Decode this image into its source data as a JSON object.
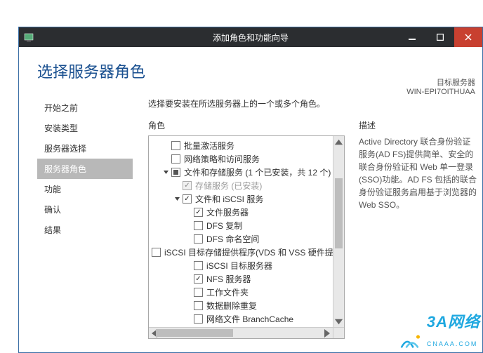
{
  "window": {
    "title": "添加角色和功能向导"
  },
  "header": {
    "page_title": "选择服务器角色",
    "dest_label": "目标服务器",
    "dest_name": "WIN-EPI7OITHUAA"
  },
  "nav": {
    "items": [
      {
        "label": "开始之前",
        "selected": false,
        "sub": false
      },
      {
        "label": "安装类型",
        "selected": false,
        "sub": false
      },
      {
        "label": "服务器选择",
        "selected": false,
        "sub": false
      },
      {
        "label": "服务器角色",
        "selected": true,
        "sub": false
      },
      {
        "label": "功能",
        "selected": false,
        "sub": false
      },
      {
        "label": "确认",
        "selected": false,
        "sub": false
      },
      {
        "label": "结果",
        "selected": false,
        "sub": false
      }
    ]
  },
  "main": {
    "instruction": "选择要安装在所选服务器上的一个或多个角色。",
    "roles_header": "角色",
    "desc_header": "描述",
    "description": "Active Directory 联合身份验证服务(AD FS)提供简单、安全的联合身份验证和 Web 单一登录(SSO)功能。AD FS 包括的联合身份验证服务启用基于浏览器的 Web SSO。"
  },
  "tree": [
    {
      "indent": 1,
      "expander": "none",
      "cb": "unchecked",
      "label": "批量激活服务"
    },
    {
      "indent": 1,
      "expander": "none",
      "cb": "unchecked",
      "label": "网络策略和访问服务"
    },
    {
      "indent": 1,
      "expander": "open",
      "cb": "mixed",
      "label": "文件和存储服务 (1 个已安装，共 12 个)"
    },
    {
      "indent": 2,
      "expander": "none",
      "cb": "checked",
      "disabled": true,
      "label": "存储服务 (已安装)"
    },
    {
      "indent": 2,
      "expander": "open",
      "cb": "checked",
      "label": "文件和 iSCSI 服务"
    },
    {
      "indent": 3,
      "expander": "none",
      "cb": "checked",
      "label": "文件服务器"
    },
    {
      "indent": 3,
      "expander": "none",
      "cb": "unchecked",
      "label": "DFS 复制"
    },
    {
      "indent": 3,
      "expander": "none",
      "cb": "unchecked",
      "label": "DFS 命名空间"
    },
    {
      "indent": 3,
      "expander": "none",
      "cb": "unchecked",
      "label": "iSCSI 目标存储提供程序(VDS 和 VSS 硬件提供程序)"
    },
    {
      "indent": 3,
      "expander": "none",
      "cb": "unchecked",
      "label": "iSCSI 目标服务器"
    },
    {
      "indent": 3,
      "expander": "none",
      "cb": "checked",
      "label": "NFS 服务器"
    },
    {
      "indent": 3,
      "expander": "none",
      "cb": "unchecked",
      "label": "工作文件夹"
    },
    {
      "indent": 3,
      "expander": "none",
      "cb": "unchecked",
      "label": "数据删除重复"
    },
    {
      "indent": 3,
      "expander": "none",
      "cb": "unchecked",
      "label": "网络文件 BranchCache"
    }
  ],
  "watermark": {
    "brand": "3A网络",
    "sub": "CNAAA.COM"
  }
}
